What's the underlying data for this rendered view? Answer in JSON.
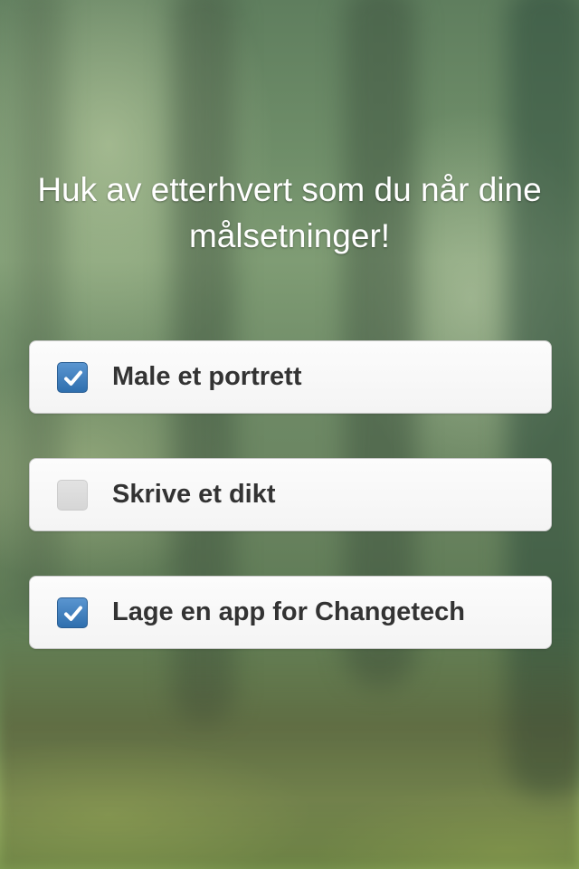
{
  "heading": "Huk av etterhvert som du når dine målsetninger!",
  "goals": [
    {
      "label": "Male et portrett",
      "checked": true
    },
    {
      "label": "Skrive et dikt",
      "checked": false
    },
    {
      "label": "Lage en app for Changetech",
      "checked": true
    }
  ],
  "colors": {
    "checkbox_checked": "#3a7bbd",
    "checkbox_unchecked": "#dcdcdc",
    "item_background": "#f7f7f7",
    "label_text": "#333333",
    "heading_text": "#ffffff"
  },
  "icons": {
    "checkmark": "checkmark-icon",
    "background": "blurred-forest-image"
  }
}
